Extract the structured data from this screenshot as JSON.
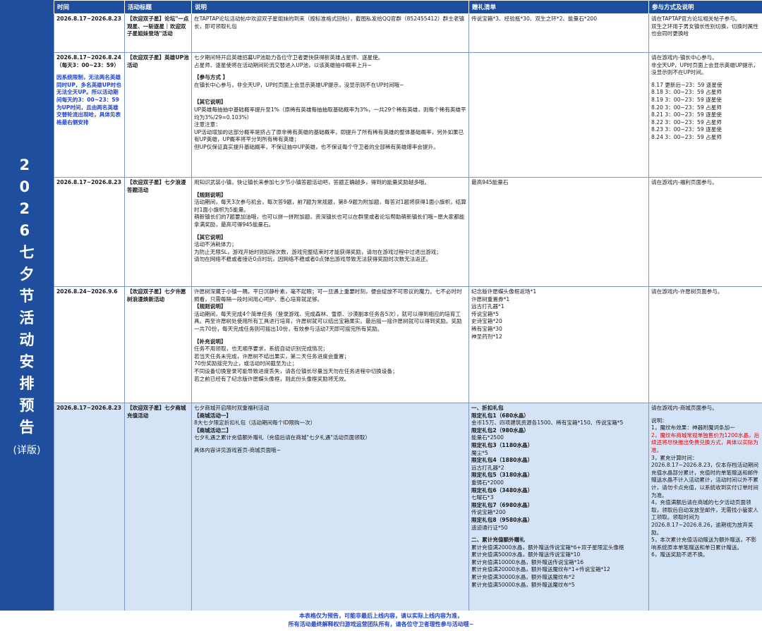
{
  "sidebar": {
    "title_chars": [
      "2",
      "0",
      "2",
      "6",
      "七",
      "夕",
      "节",
      "活",
      "动",
      "安",
      "排",
      "预",
      "告"
    ],
    "subtitle": "(详版)"
  },
  "headers": {
    "time": "时间",
    "title": "活动标题",
    "desc": "说明",
    "rewards": "赠礼清单",
    "method": "参与方式及说明"
  },
  "rows": [
    {
      "time": "2026.8.17~2026.8.23",
      "title": "【欢迎双子星】论坛\"一点观星、一斩逐星｜欢迎双子星姐妹登场\"活动",
      "desc": [
        "在TAPTAP论坛活动帖中欢迎双子星姐妹的到来（按标准格式回帖），截图私发给QQ官群（852455412）群主老镇长，即可领取礼包"
      ],
      "rewards": [
        "传说宝箱*3、经验瓶*30、双生之环*2、能量石*200"
      ],
      "method": [
        "请在TAPTAP官方论坛相关帖子参与。",
        "双生之环用于男女镇长性别切换，切换时属性也会同时更换哈"
      ]
    },
    {
      "time": "2026.8.17~2026.8.24",
      "time_sub": "（每天3：00~23：59）",
      "time_note": "因系统限制，无法两名英雄同时UP，多名英雄UP时也无法全天UP。所以活动期间每天的3：00~23：59为UP时间，且由两名英雄交替轮流出现哈，具体见表格最右侧安排",
      "title": "【欢迎双子星】英雄UP池活动",
      "desc": [
        "七夕期间特开启英雄招募UP池助力各位守卫者更快获得新英雄占星师、逐星使。",
        "占星师、逐星使将在活动期间轮流交替进入UP池，以该英雄抽中概率上升~",
        "",
        "【参与方式 】",
        "在镇长中心参与，非全天UP，UP时页面上会显示英雄UP提示，没显示则不在UP时间哦~",
        "",
        "",
        "【其它说明】",
        " UP英雄每抽抽中基础概率提升至1%（原稀有英雄每抽抽取基础概率为3%，一共29个稀有英雄，则每个稀有英雄平均为3%/29=0.103%）",
        "注意注意：",
        "UP活动增加的这部分概率是挤占了原非稀有英雄的基础概率，即提升了所有稀有英雄的整体基础概率，另外如果已有UP英雄，UP概率将平分到所有稀有英雄；",
        "但UP仅保证真实提升基础概率，不保证抽中UP英雄，也不保证每个守卫者的全部稀有英雄爆率会提升。"
      ],
      "rewards": [],
      "method": [
        "请在游戏内-镇长中心参与。",
        "非全天UP，UP时页面上会显示英雄UP提示，没显示则不在UP时间。",
        "",
        "8.17  更新后~23：59 逐星使",
        "8.18 3：00~23：59 占星师",
        "8.19 3：00~23：59 逐星使",
        "8.20 3：00~23：59 占星师",
        "8.21 3：00~23：59 逐星使",
        "8.22 3：00~23：59 占星师",
        "8.23 3：00~23：59 逐星使",
        "8.24 3：00~23：59 占星师"
      ]
    },
    {
      "time": "2026.8.17~2026.8.23",
      "title": "【欢迎双子星】七夕浪漫答题活动",
      "desc": [
        "用知识武装小镇，快让镇长来参加七夕节小镇答题活动吧，答题正确越多，得到的能量奖励越多哦。",
        "",
        "【规则说明】",
        "活动期间，每天3次参与机会，每次答9题，前7题为常规题，第8-9题为附加题，每答对1题将获得1面小旗帜，结算时1面小旗帜为5能量。",
        "萌新镇长们的7题要加油哦，也可以拼一拼附加题，资深镇长也可以在群里或者论坛帮助萌新镇长们哦~愿大家都能拿满奖励，最高可得945能量石。",
        "",
        "【其它说明】",
        "活动不消耗体力；",
        "为防止无限SL，游戏开始时则扣除次数，游戏完整结束时才能获得奖励，请勿在游戏过程中过退出游戏；",
        "请勿在网络不稳或者接近0点时玩，因网络不稳或者0点弹出游戏导致无法获得奖励时次数无法返还。"
      ],
      "rewards": [
        "最高945能量石"
      ],
      "method": [
        "请在游戏内-福利页面参与。"
      ]
    },
    {
      "time": "2026.8.24~2026.9.6",
      "title": "【欢迎双子星】七夕许愿树浪漫焕新活动",
      "desc": [
        "许愿树深藏于小镇一隅，平日沉静朴素，毫不起眼；可一旦遇上重要时刻，便会绽放不可思议的魔力。七不必时时照看，只需每隔一段时间用心呵护、悉心培育就足够。",
        "【规则说明】",
        "活动期间，每天完成4个简单任务（登录游戏、完成森林、雪原、沙漠副本任务各5次），就可以得到相应的培育工具。再至许愿树处使用所有工具进行培育，许愿树就可以结出宝箱果实。最后摇一摇许愿树就可以得到奖励。奖励一共70份，每天完成任务则可摇出10份，有效参与活动7天即可摇完所有奖励。",
        "",
        "【补充说明】",
        "任务不用领取，也无顺序要求，系统自动识别完成情况；",
        "若当天任务未完成，许愿树不结出果实，第二天任务进度会重置；",
        "70份奖励摇完为止，或活动时间截至为止；",
        "不同设备切换登录可能导致进度丢失，请各位镇长尽量当天勿在任务进程中切换设备；",
        "若之前已经有了纪念版许愿蝶头像框，则此份头像框奖励将无效。"
      ],
      "rewards": [
        "纪念版许愿蝶头像框返场*1",
        "许愿树重置券*1",
        "远古打孔器*1",
        "传说宝箱*5",
        "史诗宝箱*20",
        "稀有宝箱*30",
        "神圣药剂*12"
      ],
      "method": [
        "请在游戏内-许愿树页面参与。"
      ]
    },
    {
      "time": "2026.8.17~2026.8.23",
      "title": "【欢迎双子星】七夕商城充值活动",
      "desc": [
        "七夕商城开启限时双重福利活动",
        "【商城活动一】",
        "8大七夕限定折扣礼包（活动期间每个ID限购一次）",
        "【商城活动二】",
        "七夕礼遇之累计充值额外赠礼（充值后请在商城\"七夕礼遇\"活动页面领取）",
        "",
        "具体内容详见游戏首页-商城页面哦~"
      ],
      "rewards": {
        "sec1": "一、折扣礼包",
        "packs": [
          {
            "name": "限定礼包1（680水晶）",
            "items": "金币15万、四项建筑资源各1500、稀有宝箱*150、传说宝箱*5"
          },
          {
            "name": "限定礼包2（980水晶）",
            "items": "能量石*2500"
          },
          {
            "name": "限定礼包3（1180水晶）",
            "items": "魔尘*5"
          },
          {
            "name": "限定礼包4（1880水晶）",
            "items": "远古打孔器*2"
          },
          {
            "name": "限定礼包5（3180水晶）",
            "items": "重铸石*2000"
          },
          {
            "name": "限定礼包6（3480水晶）",
            "items": "七曜石*3"
          },
          {
            "name": "限定礼包7（6980水晶）",
            "items": "传说宝箱*200"
          },
          {
            "name": "限定礼包8（9580水晶）",
            "items": "遗迹通行证*50"
          }
        ],
        "sec2": "二、累计充值额外赠礼",
        "totals": [
          "累计充值满2000水晶，额外赠送传说宝箱*6+双子星限定头像框",
          "累计充值满5000水晶，额外赠送传说宝箱*10",
          "累计充值满10000水晶，额外赠送传说宝箱*16",
          "累计充值满20000水晶，额外赠送魔纹布*1+传说宝箱*12",
          "累计充值满30000水晶，额外赠送魔纹布*2",
          "累计充值满50000水晶，额外赠送魔纹布*5"
        ]
      },
      "method": {
        "lines_a": [
          "请在游戏内-商城页面参与。",
          "",
          "说明：",
          "1，魔纹布效果：神器附魔词条加一"
        ],
        "red": "2，魔纹布商城常规单独售价为1200水晶，后续还将尽快推出免费兑换方式，具体以实际为准。",
        "lines_b": [
          "3，累充计算时间：",
          "2026.8.17~2026.8.23，仅本存档活动期间充值水晶部分累计，充值时的单笔赠送和邮件赠送水晶不计入活动累计，活动时间以外不累计，请勿卡点充值，以系统收到实付订单时间为准。",
          "4，充值满额后请在商城的七夕活动页面领取，领取后自动发放至邮件，无需找小管家人工领取。领取时间为2026.8.17~2026.8.26，逾期视为放弃奖励。",
          "5，本次累计充值活动赠送为额外赠送，不影响系统原本单笔赠送和单日累计赠送。",
          "6，赠送奖励不退不换。"
        ]
      }
    }
  ],
  "footer": {
    "line1": "本表格仅为预告，可能非最后上线内容，请以实际上线内容为准，",
    "line2": "所有活动最终解释权归游戏运营团队所有，请各位守卫者理性参与活动哦~"
  }
}
